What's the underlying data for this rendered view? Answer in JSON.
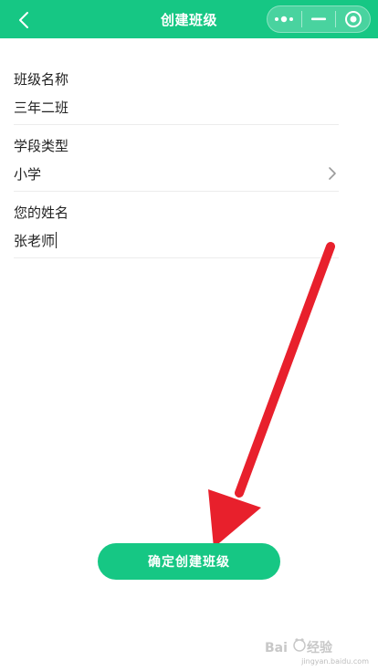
{
  "navbar": {
    "title": "创建班级",
    "back_icon": "chevron-left-icon",
    "more_icon": "more-dots-icon",
    "minimize_icon": "minimize-icon",
    "close_icon": "target-icon"
  },
  "form": {
    "fields": [
      {
        "label": "班级名称",
        "value": "三年二班"
      },
      {
        "label": "学段类型",
        "value": "小学"
      },
      {
        "label": "您的姓名",
        "value": "张老师"
      }
    ]
  },
  "submit_label": "确定创建班级",
  "watermark": {
    "text": "jingyan.baidu.com"
  },
  "colors": {
    "primary": "#16c784",
    "arrow": "#e8202c"
  }
}
